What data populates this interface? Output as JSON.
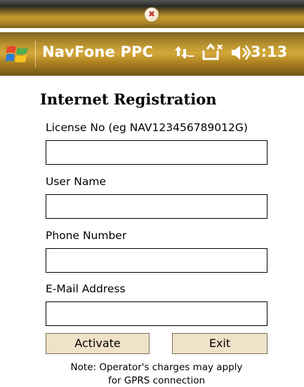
{
  "taskbar": {
    "notification_icon": "msn-notification-icon",
    "notification_glyph": "✖"
  },
  "title_bar": {
    "start_icon": "windows-flag-icon",
    "title": "NavFone PPC",
    "status_icons": [
      "connectivity-arrows-icon",
      "no-signal-phone-icon",
      "speaker-icon"
    ],
    "time": "3:13"
  },
  "form": {
    "heading": "Internet Registration",
    "license": {
      "label": "License No (eg NAV123456789012G)",
      "value": ""
    },
    "username": {
      "label": "User Name",
      "value": ""
    },
    "phone": {
      "label": "Phone Number",
      "value": ""
    },
    "email": {
      "label": "E-Mail Address",
      "value": ""
    },
    "activate_label": "Activate",
    "exit_label": "Exit",
    "note_line1": "Note: Operator's charges may apply",
    "note_line2": "for GPRS connection"
  },
  "colors": {
    "titlebar_gold": "#c49a31",
    "button_bg": "#f0e2c8"
  }
}
